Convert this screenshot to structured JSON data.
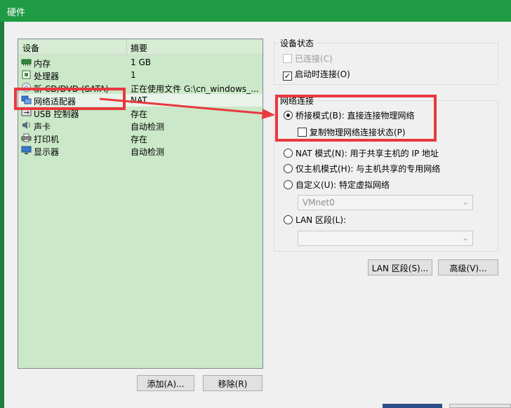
{
  "window": {
    "title": "硬件"
  },
  "device_list": {
    "columns": [
      "设备",
      "摘要"
    ],
    "items": [
      {
        "icon": "memory-icon",
        "name": "内存",
        "summary": "1 GB"
      },
      {
        "icon": "cpu-icon",
        "name": "处理器",
        "summary": "1"
      },
      {
        "icon": "cd-dvd-icon",
        "name": "新 CD/DVD (SATA)",
        "summary": "正在使用文件 G:\\cn_windows_..."
      },
      {
        "icon": "network-adapter-icon",
        "name": "网络适配器",
        "summary": "NAT"
      },
      {
        "icon": "usb-icon",
        "name": "USB 控制器",
        "summary": "存在"
      },
      {
        "icon": "sound-icon",
        "name": "声卡",
        "summary": "自动检测"
      },
      {
        "icon": "printer-icon",
        "name": "打印机",
        "summary": "存在"
      },
      {
        "icon": "display-icon",
        "name": "显示器",
        "summary": "自动检测"
      }
    ],
    "selected_index": 3
  },
  "buttons": {
    "add": "添加(A)...",
    "remove": "移除(R)",
    "lan_segments": "LAN 区段(S)...",
    "advanced": "高级(V)..."
  },
  "device_status": {
    "title": "设备状态",
    "connected": {
      "label": "已连接(C)",
      "checked": false,
      "disabled": true
    },
    "connect_at_power_on": {
      "label": "启动时连接(O)",
      "checked": true
    }
  },
  "network_connection": {
    "title": "网络连接",
    "bridged": {
      "label": "桥接模式(B): 直接连接物理网络",
      "selected": true
    },
    "replicate": {
      "label": "复制物理网络连接状态(P)",
      "checked": false
    },
    "nat": {
      "label": "NAT 模式(N): 用于共享主机的 IP 地址",
      "selected": false
    },
    "host_only": {
      "label": "仅主机模式(H): 与主机共享的专用网络",
      "selected": false
    },
    "custom": {
      "label": "自定义(U): 特定虚拟网络",
      "selected": false
    },
    "custom_select": "VMnet0",
    "lan_segment": {
      "label": "LAN 区段(L):",
      "selected": false
    },
    "lan_select": ""
  },
  "colors": {
    "title_bar": "#1e9b43",
    "list_background": "#cbe8c8",
    "highlight_red": "#e8393f"
  }
}
